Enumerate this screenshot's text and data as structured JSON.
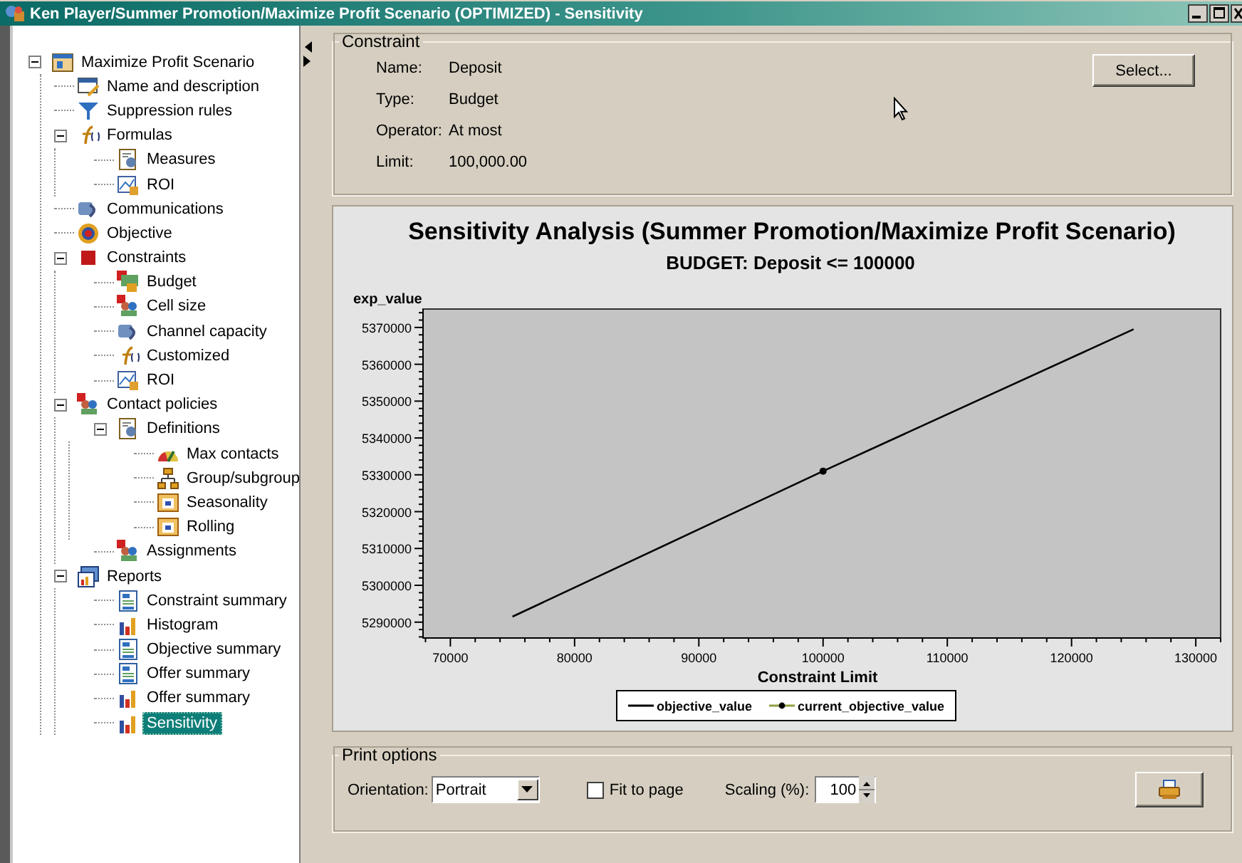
{
  "window": {
    "title": "Ken Player/Summer Promotion/Maximize Profit Scenario (OPTIMIZED) - Sensitivity"
  },
  "tree": [
    {
      "label": "Maximize Profit Scenario",
      "kind": "scenario",
      "expanded": true,
      "selected": false,
      "children": [
        {
          "label": "Name and description",
          "kind": "edit",
          "selected": false
        },
        {
          "label": "Suppression rules",
          "kind": "filter",
          "selected": false
        },
        {
          "label": "Formulas",
          "kind": "formula",
          "expanded": true,
          "selected": false,
          "children": [
            {
              "label": "Measures",
              "kind": "measure",
              "selected": false
            },
            {
              "label": "ROI",
              "kind": "roi",
              "selected": false
            }
          ]
        },
        {
          "label": "Communications",
          "kind": "channel",
          "selected": false
        },
        {
          "label": "Objective",
          "kind": "target",
          "selected": false
        },
        {
          "label": "Constraints",
          "kind": "constraint",
          "expanded": true,
          "selected": false,
          "children": [
            {
              "label": "Budget",
              "kind": "budget",
              "selected": false
            },
            {
              "label": "Cell size",
              "kind": "people",
              "selected": false
            },
            {
              "label": "Channel capacity",
              "kind": "channel",
              "selected": false
            },
            {
              "label": "Customized",
              "kind": "formula",
              "selected": false
            },
            {
              "label": "ROI",
              "kind": "roi",
              "selected": false
            }
          ]
        },
        {
          "label": "Contact policies",
          "kind": "people",
          "expanded": true,
          "selected": false,
          "children": [
            {
              "label": "Definitions",
              "kind": "measure",
              "expanded": true,
              "selected": false,
              "children": [
                {
                  "label": "Max contacts",
                  "kind": "gauge",
                  "selected": false
                },
                {
                  "label": "Group/subgroup",
                  "kind": "hierarchy",
                  "selected": false
                },
                {
                  "label": "Seasonality",
                  "kind": "calendar",
                  "selected": false
                },
                {
                  "label": "Rolling",
                  "kind": "calendar",
                  "selected": false
                }
              ]
            },
            {
              "label": "Assignments",
              "kind": "people",
              "selected": false
            }
          ]
        },
        {
          "label": "Reports",
          "kind": "reports",
          "expanded": true,
          "selected": false,
          "children": [
            {
              "label": "Constraint summary",
              "kind": "document",
              "selected": false
            },
            {
              "label": "Histogram",
              "kind": "barchart",
              "selected": false
            },
            {
              "label": "Objective summary",
              "kind": "document",
              "selected": false
            },
            {
              "label": "Offer summary",
              "kind": "document",
              "selected": false
            },
            {
              "label": "Offer summary",
              "kind": "barchart",
              "selected": false
            },
            {
              "label": "Sensitivity",
              "kind": "barchart",
              "selected": true
            }
          ]
        }
      ]
    }
  ],
  "constraint": {
    "title": "Constraint",
    "fields": [
      {
        "label": "Name:",
        "value": "Deposit"
      },
      {
        "label": "Type:",
        "value": "Budget"
      },
      {
        "label": "Operator:",
        "value": "At most"
      },
      {
        "label": "Limit:",
        "value": "100,000.00"
      }
    ],
    "select_button": "Select..."
  },
  "chart": {
    "subtitle": "BUDGET: Deposit <= 100000",
    "chart_data": {
      "type": "line",
      "title": "Sensitivity Analysis (Summer Promotion/Maximize Profit Scenario)",
      "xlabel": "Constraint Limit",
      "ylabel": "exp_value",
      "x": [
        75000,
        100000,
        125000
      ],
      "series": [
        {
          "name": "objective_value",
          "color": "#000000",
          "values": [
            5291500,
            5331000,
            5369500
          ]
        },
        {
          "name": "current_objective_value",
          "color": "#000000",
          "marker": "circle",
          "values": [
            null,
            5331000,
            null
          ]
        }
      ],
      "legend": true,
      "xlim": [
        67800,
        132000
      ],
      "ylim": [
        5285700,
        5375000
      ],
      "xticks": [
        70000,
        80000,
        90000,
        100000,
        110000,
        120000,
        130000
      ],
      "yticks": [
        5290000,
        5300000,
        5310000,
        5320000,
        5330000,
        5340000,
        5350000,
        5360000,
        5370000
      ]
    }
  },
  "print_options": {
    "title": "Print options",
    "orientation_label": "Orientation:",
    "orientation": "Portrait",
    "fit_to_page": {
      "label": "Fit to page",
      "checked": false
    },
    "scaling_label": "Scaling (%):",
    "scaling": "100"
  }
}
